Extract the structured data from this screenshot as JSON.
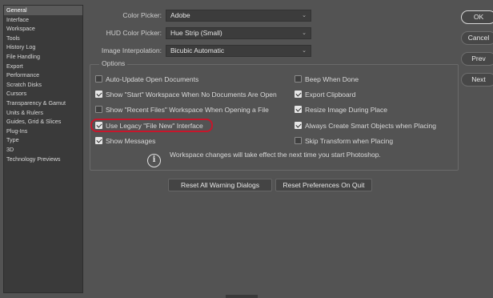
{
  "sidebar": {
    "items": [
      {
        "label": "General",
        "active": true
      },
      {
        "label": "Interface"
      },
      {
        "label": "Workspace"
      },
      {
        "label": "Tools"
      },
      {
        "label": "History Log"
      },
      {
        "label": "File Handling"
      },
      {
        "label": "Export"
      },
      {
        "label": "Performance"
      },
      {
        "label": "Scratch Disks"
      },
      {
        "label": "Cursors"
      },
      {
        "label": "Transparency & Gamut"
      },
      {
        "label": "Units & Rulers"
      },
      {
        "label": "Guides, Grid & Slices"
      },
      {
        "label": "Plug-Ins"
      },
      {
        "label": "Type"
      },
      {
        "label": "3D"
      },
      {
        "label": "Technology Previews"
      }
    ]
  },
  "actions": {
    "ok": "OK",
    "cancel": "Cancel",
    "prev": "Prev",
    "next": "Next"
  },
  "fields": {
    "color_picker": {
      "label": "Color Picker:",
      "value": "Adobe"
    },
    "hud_color_picker": {
      "label": "HUD Color Picker:",
      "value": "Hue Strip (Small)"
    },
    "image_interpolation": {
      "label": "Image Interpolation:",
      "value": "Bicubic Automatic"
    }
  },
  "options": {
    "title": "Options",
    "left": [
      {
        "label": "Auto-Update Open Documents",
        "checked": false
      },
      {
        "label": "Show \"Start\" Workspace When No Documents Are Open",
        "checked": true
      },
      {
        "label": "Show \"Recent Files\" Workspace When Opening a File",
        "checked": false
      },
      {
        "label": "Use Legacy \"File New\" Interface",
        "checked": true
      },
      {
        "label": "Show Messages",
        "checked": true
      }
    ],
    "right": [
      {
        "label": "Beep When Done",
        "checked": false
      },
      {
        "label": "Export Clipboard",
        "checked": true
      },
      {
        "label": "Resize Image During Place",
        "checked": true
      },
      {
        "label": "Always Create Smart Objects when Placing",
        "checked": true
      },
      {
        "label": "Skip Transform when Placing",
        "checked": false
      }
    ],
    "info_icon": "info-icon",
    "info_text": "Workspace changes will take effect the next time you start Photoshop."
  },
  "bottom_buttons": {
    "reset_warnings": "Reset All Warning Dialogs",
    "reset_prefs": "Reset Preferences On Quit"
  },
  "colors": {
    "highlight": "#c7162b",
    "background": "#535353",
    "sidebar": "#3a3a3a"
  }
}
